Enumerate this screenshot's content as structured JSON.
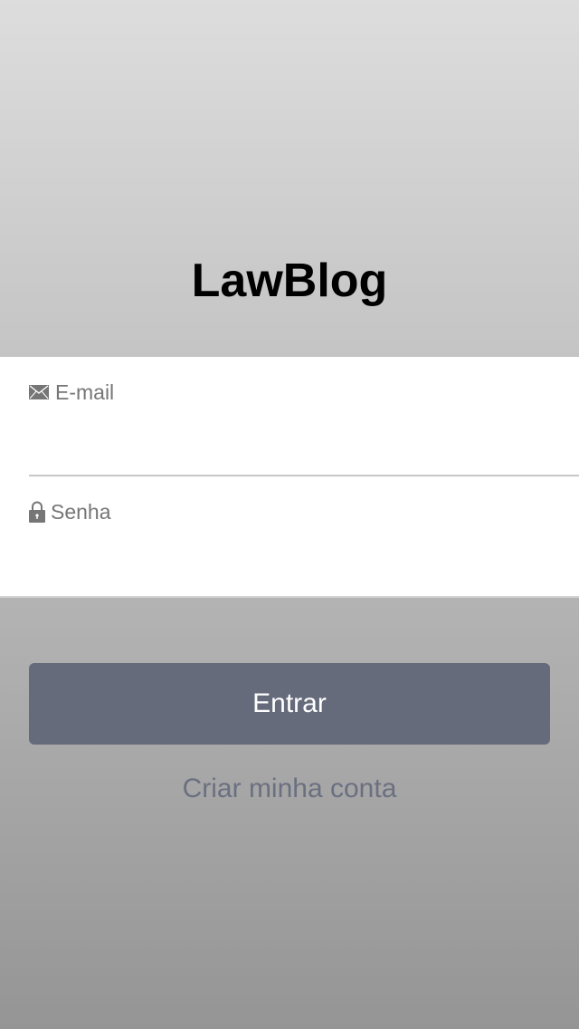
{
  "app": {
    "title": "LawBlog"
  },
  "login_form": {
    "email": {
      "label": "E-mail",
      "value": "",
      "icon": "envelope-icon"
    },
    "password": {
      "label": "Senha",
      "value": "",
      "icon": "lock-icon"
    }
  },
  "actions": {
    "login_label": "Entrar",
    "create_account_label": "Criar minha conta"
  },
  "colors": {
    "button_bg": "#666b7b",
    "link_text": "#6b7080",
    "label_text": "#767676"
  }
}
